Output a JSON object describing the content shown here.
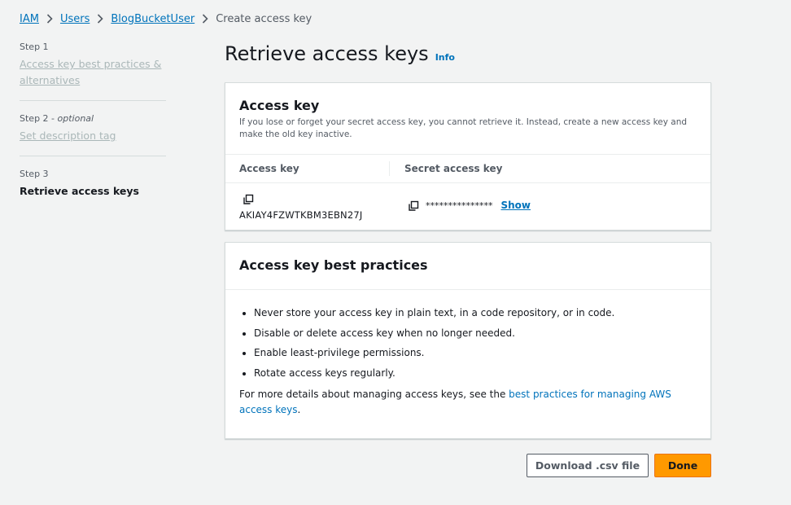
{
  "breadcrumb": {
    "items": [
      "IAM",
      "Users",
      "BlogBucketUser"
    ],
    "current": "Create access key"
  },
  "steps": [
    {
      "label": "Step 1",
      "optional": "",
      "title": "Access key best practices & alternatives"
    },
    {
      "label": "Step 2 - ",
      "optional": "optional",
      "title": "Set description tag"
    },
    {
      "label": "Step 3",
      "optional": "",
      "title": "Retrieve access keys"
    }
  ],
  "page": {
    "title": "Retrieve access keys",
    "info": "Info"
  },
  "access_key_panel": {
    "title": "Access key",
    "description": "If you lose or forget your secret access key, you cannot retrieve it. Instead, create a new access key and make the old key inactive.",
    "col_access_key": "Access key",
    "col_secret": "Secret access key",
    "access_key_value": "AKIAY4FZWTKBM3EBN27J",
    "secret_masked": "***************",
    "show_label": "Show"
  },
  "best_practices": {
    "title": "Access key best practices",
    "items": [
      "Never store your access key in plain text, in a code repository, or in code.",
      "Disable or delete access key when no longer needed.",
      "Enable least-privilege permissions.",
      "Rotate access keys regularly."
    ],
    "more_prefix": "For more details about managing access keys, see the ",
    "more_link": "best practices for managing AWS access keys",
    "more_suffix": "."
  },
  "buttons": {
    "download": "Download .csv file",
    "done": "Done"
  },
  "colors": {
    "primary": "#ff9900",
    "link": "#0073bb",
    "background": "#f2f3f3"
  }
}
